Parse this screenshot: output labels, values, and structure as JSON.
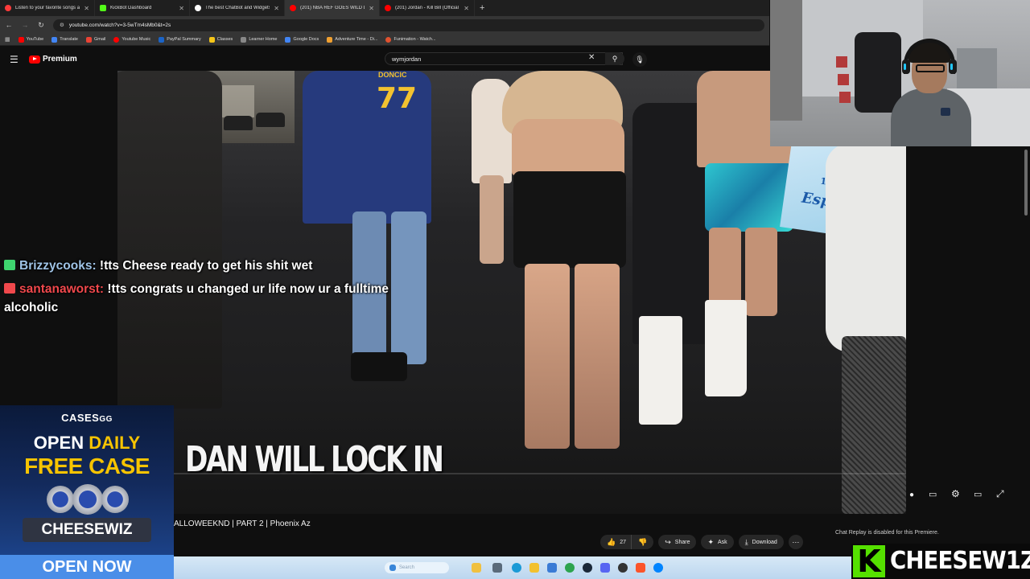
{
  "browser": {
    "tabs": [
      {
        "label": "Listen to your favorite songs and",
        "color": "#ff3b3b",
        "active": false
      },
      {
        "label": "KickBot Dashboard",
        "color": "#53fc18",
        "active": false
      },
      {
        "label": "The best ChatBot and Widgets",
        "color": "#ffffff",
        "active": false
      },
      {
        "label": "(201) NBA REF GOES WILD DUI",
        "color": "#ff0000",
        "active": true
      },
      {
        "label": "(201) Jordan - Kill Bill (Official M",
        "color": "#ff0000",
        "active": false
      }
    ],
    "url": "youtube.com/watch?v=3-5wTm4sMb0&t=2s",
    "bookmarks": [
      {
        "label": "YouTube",
        "color": "#ff0000"
      },
      {
        "label": "Translate",
        "color": "#4285f4"
      },
      {
        "label": "Gmail",
        "color": "#ea4335"
      },
      {
        "label": "Youtube Music",
        "color": "#ff0000"
      },
      {
        "label": "PayPal Summary",
        "color": "#1b64c7"
      },
      {
        "label": "Classes",
        "color": "#f5c518"
      },
      {
        "label": "Learner Home",
        "color": "#888888"
      },
      {
        "label": "Google Docs",
        "color": "#4285f4"
      },
      {
        "label": "Adventure Time - Di...",
        "color": "#f0a030"
      },
      {
        "label": "Funimation - Watch...",
        "color": "#7a3bd1"
      }
    ]
  },
  "youtube": {
    "logo_text": "Premium",
    "search_value": "wymjordan"
  },
  "video": {
    "caption": "DAN WILL LOCK IN",
    "title": "ALLOWEEKND | PART 2 | Phoenix Az",
    "jersey_number": "77",
    "jersey_name": "DONCIC",
    "banner_year": "1925",
    "banner_word": "Especial"
  },
  "chat": [
    {
      "user": "Brizzycooks:",
      "message": " !tts Cheese ready to get his shit wet",
      "badge_color": "#3fd46f"
    },
    {
      "user": "santanaworst:",
      "message": " !tts congrats u changed ur life now ur a fulltime alcoholic",
      "badge_color": "#f0484c"
    }
  ],
  "actions": {
    "like_count": "27",
    "share_label": "Share",
    "ask_label": "Ask",
    "download_label": "Download"
  },
  "chat_replay_notice": "Chat Replay is disabled for this Premiere.",
  "ad": {
    "logo": "CASES",
    "logo_suffix": "GG",
    "line1_a": "OPEN ",
    "line1_b": "DAILY",
    "line2": "FREE CASE",
    "code": "CHEESEWIZ",
    "cta": "OPEN NOW"
  },
  "taskbar": {
    "search_placeholder": "Search"
  },
  "watermark": {
    "letter": "K",
    "name": "CHEESEW1Z"
  }
}
